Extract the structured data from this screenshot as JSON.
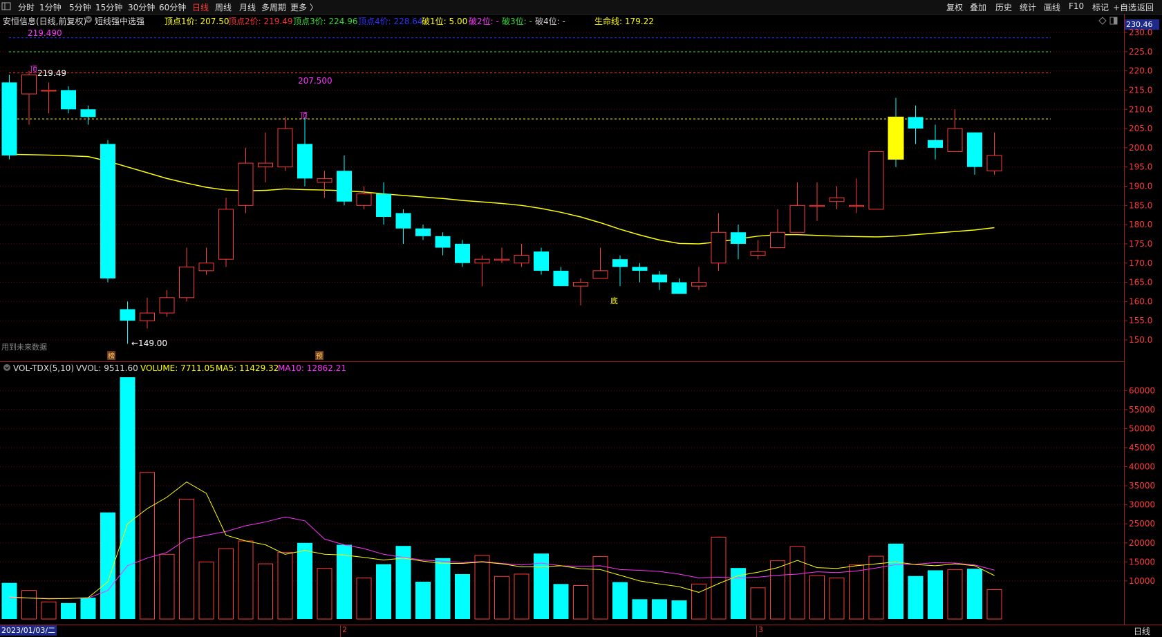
{
  "toolbar": {
    "left_items": [
      "分时",
      "1分钟",
      "5分钟",
      "15分钟",
      "30分钟",
      "60分钟",
      "日线",
      "周线",
      "月线",
      "多周期",
      "更多 〉"
    ],
    "active_item": "日线",
    "right_items": [
      "复权",
      "叠加",
      "历史",
      "统计",
      "画线",
      "F10",
      "标记",
      "+自选",
      "返回"
    ]
  },
  "info_bar": {
    "stock": "安恒信息(日线,前复权)",
    "indicator": "短线强中选强",
    "labels": [
      {
        "text": "顶点1价: 207.50",
        "color": "#ffff00"
      },
      {
        "text": "顶点2价: 219.49",
        "color": "#ff3030"
      },
      {
        "text": "顶点3价: 224.96",
        "color": "#33dd33"
      },
      {
        "text": "顶点4价: 228.64",
        "color": "#3030ff"
      },
      {
        "text": "破1位: 5.00",
        "color": "#ffff00"
      },
      {
        "text": "破2位: -",
        "color": "#ff33ff"
      },
      {
        "text": "破3位: -",
        "color": "#33dd33"
      },
      {
        "text": "破4位: -",
        "color": "#cccccc"
      },
      {
        "text": "生命线: 179.22",
        "color": "#ffff00"
      }
    ],
    "current_price": "230.46"
  },
  "annotations": {
    "level_top_label": "219.490",
    "level_207_label": "207.500",
    "high_label": "219.49",
    "low_label": "←149.00",
    "ding_char": "顶",
    "di_char": "底",
    "future_data": "用到未来数据",
    "bang_char": "榜",
    "yu_char": "预"
  },
  "volume_info": {
    "name": "VOL-TDX(5,10)",
    "vvol": "VVOL: 9511.60",
    "volume": "VOLUME: 7711.05",
    "ma5": "MA5: 11429.32",
    "ma10": "MA10: 12862.21"
  },
  "bottom": {
    "date": "2023/01/03/二",
    "month2": "2",
    "month3": "3",
    "period": "日线"
  },
  "colors": {
    "up": "#ff3a3a",
    "down": "#00ffff",
    "ma_life": "#ffff00",
    "vol_ma5": "#ffff00",
    "vol_ma10": "#ff33ff"
  },
  "chart_data": {
    "type": "candlestick",
    "price_axis": {
      "ticks": [
        150,
        155,
        160,
        165,
        170,
        175,
        180,
        185,
        190,
        195,
        200,
        205,
        210,
        215,
        220,
        225,
        230
      ],
      "range": [
        145,
        232
      ]
    },
    "volume_axis": {
      "ticks": [
        10000,
        15000,
        20000,
        25000,
        30000,
        35000,
        40000,
        45000,
        50000,
        55000,
        60000
      ],
      "range": [
        0,
        63500
      ]
    },
    "levels": [
      {
        "name": "顶点1价",
        "value": 207.5,
        "color": "#ffff00"
      },
      {
        "name": "顶点2价",
        "value": 219.49,
        "color": "#ff3030"
      },
      {
        "name": "顶点3价",
        "value": 224.96,
        "color": "#33dd33"
      },
      {
        "name": "顶点4价",
        "value": 228.64,
        "color": "#3030ff"
      }
    ],
    "candles": [
      [
        217,
        198,
        219,
        197
      ],
      [
        214,
        219,
        220,
        206
      ],
      [
        215,
        215,
        217,
        209
      ],
      [
        215,
        210,
        216,
        209
      ],
      [
        210,
        208,
        211,
        206
      ],
      [
        201,
        166,
        202,
        165
      ],
      [
        158,
        155,
        160,
        149
      ],
      [
        155,
        157,
        161,
        153
      ],
      [
        157,
        161,
        163,
        156
      ],
      [
        161,
        169,
        174,
        160
      ],
      [
        168,
        170,
        174,
        167
      ],
      [
        171,
        184,
        187,
        169
      ],
      [
        185,
        196,
        200,
        183
      ],
      [
        195,
        196,
        204,
        191
      ],
      [
        195,
        205,
        208,
        194
      ],
      [
        201,
        192,
        208,
        190
      ],
      [
        191,
        192,
        194,
        187
      ],
      [
        194,
        186,
        198,
        185
      ],
      [
        185,
        188,
        190,
        184
      ],
      [
        188,
        182,
        191,
        180
      ],
      [
        183,
        179,
        184,
        175
      ],
      [
        179,
        177,
        180,
        176
      ],
      [
        177,
        174,
        178,
        172
      ],
      [
        175,
        170,
        176,
        169
      ],
      [
        170,
        171,
        172,
        164
      ],
      [
        171,
        171,
        174,
        170
      ],
      [
        170,
        172,
        175,
        169
      ],
      [
        173,
        168,
        174,
        167
      ],
      [
        168,
        164,
        169,
        164
      ],
      [
        164,
        165,
        166,
        159
      ],
      [
        166,
        168,
        174,
        167
      ],
      [
        171,
        169,
        172,
        164
      ],
      [
        169,
        168,
        170,
        165
      ],
      [
        167,
        165,
        168,
        163
      ],
      [
        165,
        162,
        166,
        162
      ],
      [
        164,
        165,
        169,
        163
      ],
      [
        170,
        178,
        183,
        168
      ],
      [
        178,
        175,
        180,
        171
      ],
      [
        172,
        173,
        176,
        171
      ],
      [
        174,
        178,
        184,
        174
      ],
      [
        178,
        185,
        191,
        178
      ],
      [
        185,
        185,
        191,
        181
      ],
      [
        186,
        187,
        190,
        184
      ],
      [
        185,
        185,
        192,
        183
      ],
      [
        184,
        199,
        199,
        184
      ],
      [
        208,
        197,
        213,
        195
      ],
      [
        208,
        205,
        211,
        201
      ],
      [
        202,
        200,
        206,
        197
      ],
      [
        199,
        205,
        210,
        199
      ],
      [
        204,
        195,
        204,
        193
      ],
      [
        194,
        198,
        204,
        193
      ]
    ],
    "candle_dates_note": "51 daily candles starting 2023/01/03",
    "life_line": [
      198.3,
      198.2,
      198.1,
      197.9,
      197.7,
      196.5,
      195,
      193.5,
      192,
      190.8,
      189.7,
      189.0,
      188.8,
      188.9,
      189.3,
      189.1,
      189.0,
      188.8,
      188.5,
      188.0,
      187.6,
      187.2,
      186.8,
      186.3,
      185.9,
      185.5,
      185.0,
      184.2,
      183.2,
      182.0,
      180.5,
      178.8,
      177.3,
      176.0,
      175.1,
      175.0,
      175.5,
      176.3,
      177.0,
      177.4,
      177.4,
      177.2,
      177.0,
      176.9,
      176.8,
      177.0,
      177.4,
      177.8,
      178.2,
      178.6,
      179.22
    ],
    "volume": [
      9500,
      7500,
      4500,
      4200,
      5600,
      28000,
      63500,
      38500,
      17000,
      31500,
      15000,
      18500,
      20500,
      14500,
      17500,
      20000,
      13300,
      19500,
      10800,
      14400,
      19200,
      9800,
      16000,
      11800,
      16700,
      11200,
      11800,
      17200,
      9200,
      8800,
      16400,
      9700,
      5200,
      5200,
      4900,
      9200,
      21500,
      13400,
      8200,
      15300,
      19000,
      11400,
      10800,
      14200,
      16500,
      19800,
      11300,
      12800,
      13000,
      13200,
      7711
    ],
    "vol_ma5": [
      5800,
      5500,
      5300,
      5400,
      5600,
      9800,
      25000,
      29000,
      32000,
      36000,
      33000,
      22000,
      20500,
      19500,
      17000,
      18000,
      17000,
      16800,
      16200,
      15500,
      16000,
      15200,
      14600,
      14600,
      15000,
      14500,
      13700,
      13700,
      14000,
      13200,
      13000,
      11500,
      10000,
      9200,
      8500,
      7000,
      9300,
      11400,
      12300,
      13500,
      15400,
      13500,
      13300,
      14000,
      14500,
      15000,
      14300,
      14000,
      14500,
      14000,
      11429
    ],
    "vol_ma10": [
      5600,
      5500,
      5400,
      5400,
      5500,
      7500,
      14000,
      16000,
      17500,
      21000,
      22000,
      23000,
      24500,
      25500,
      26800,
      25800,
      21000,
      19500,
      18500,
      17000,
      16200,
      15500,
      15200,
      14800,
      15100,
      14600,
      14200,
      14700,
      14000,
      13800,
      14000,
      13000,
      12800,
      12500,
      11800,
      10800,
      11000,
      10800,
      11000,
      11500,
      11800,
      12400,
      12200,
      12600,
      13400,
      14300,
      14400,
      14800,
      14700,
      14200,
      12862
    ]
  }
}
